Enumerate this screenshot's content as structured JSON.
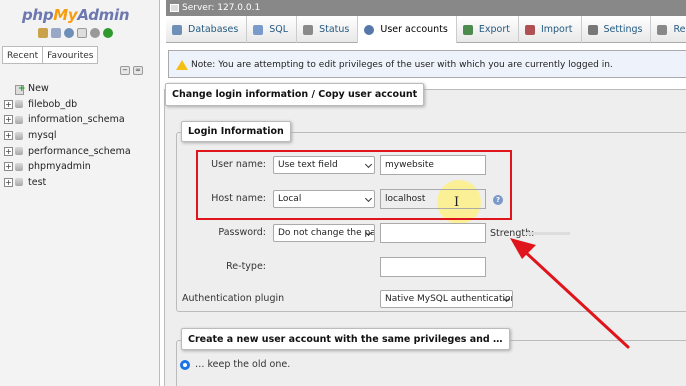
{
  "logo": {
    "php": "php",
    "my": "My",
    "admin": "Admin"
  },
  "nav": {
    "tabs": [
      "Recent",
      "Favourites"
    ],
    "tree": [
      "New",
      "filebob_db",
      "information_schema",
      "mysql",
      "performance_schema",
      "phpmyadmin",
      "test"
    ]
  },
  "server": {
    "label": "Server: 127.0.0.1"
  },
  "tabs": [
    {
      "label": "Databases",
      "color": "#6d8fb8"
    },
    {
      "label": "SQL",
      "color": "#7a9acb"
    },
    {
      "label": "Status",
      "color": "#8a8a8a"
    },
    {
      "label": "User accounts",
      "color": "#5577aa"
    },
    {
      "label": "Export",
      "color": "#4d8a4d"
    },
    {
      "label": "Import",
      "color": "#b05050"
    },
    {
      "label": "Settings",
      "color": "#777777"
    },
    {
      "label": "Replica",
      "color": "#888888"
    }
  ],
  "notice": {
    "text": "Note: You are attempting to edit privileges of the user with which you are currently logged in."
  },
  "change_login": {
    "legend": "Change login information / Copy user account"
  },
  "login_info": {
    "legend": "Login Information",
    "user_name_label": "User name:",
    "user_name_mode": "Use text field",
    "user_name_value": "mywebsite",
    "host_name_label": "Host name:",
    "host_name_mode": "Local",
    "host_name_value": "localhost",
    "help": "?",
    "password_label": "Password:",
    "password_mode": "Do not change the pa",
    "strength_label": "Strength:",
    "retype_label": "Re-type:",
    "auth_label": "Authentication plugin",
    "auth_value": "Native MySQL authentication"
  },
  "new_account": {
    "legend": "Create a new user account with the same privileges and …",
    "option_keep": "… keep the old one."
  }
}
